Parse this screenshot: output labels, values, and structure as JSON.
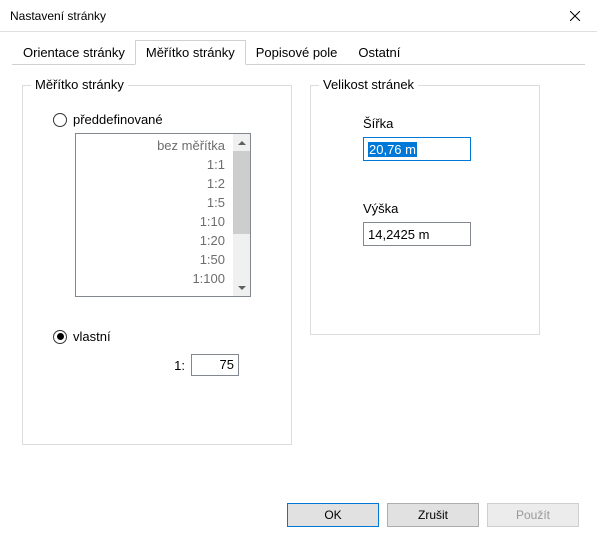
{
  "window": {
    "title": "Nastavení stránky"
  },
  "tabs": {
    "orientation": "Orientace stránky",
    "scale": "Měřítko stránky",
    "titleblock": "Popisové pole",
    "other": "Ostatní"
  },
  "scale_group": {
    "legend": "Měřítko stránky",
    "predefined_label": "předdefinované",
    "custom_label": "vlastní",
    "custom_prefix": "1:",
    "custom_value": "75",
    "list": {
      "i0": "bez měřítka",
      "i1": "1:1",
      "i2": "1:2",
      "i3": "1:5",
      "i4": "1:10",
      "i5": "1:20",
      "i6": "1:50",
      "i7": "1:100"
    }
  },
  "size_group": {
    "legend": "Velikost stránek",
    "width_label": "Šířka",
    "width_value": "20,76 m",
    "height_label": "Výška",
    "height_value": "14,2425 m"
  },
  "buttons": {
    "ok": "OK",
    "cancel": "Zrušit",
    "apply": "Použít"
  }
}
